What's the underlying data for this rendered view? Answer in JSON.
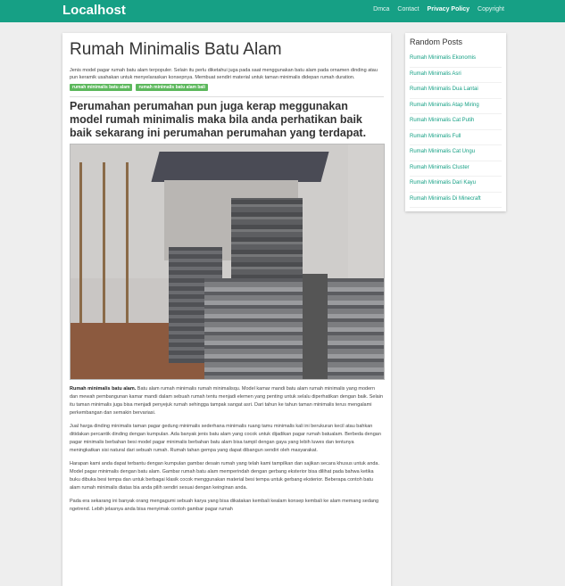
{
  "brand": "Localhost",
  "nav": [
    "Dmca",
    "Contact",
    "Privacy Policy",
    "Copyright"
  ],
  "post": {
    "title": "Rumah Minimalis Batu Alam",
    "intro": "Jenis model pagar rumah batu alam terpopuler. Selain itu perlu diketahui juga pada saat menggunakan batu alam pada ornamen dinding atau pun keramik usahakan untuk menyelaraskan konsepnya. Membuat sendiri material untuk taman minimalis didepan rumah duration.",
    "tags": [
      "rumah minimalis batu alam",
      "rumah minimalis batu alam bali"
    ],
    "subheading": "Perumahan perumahan pun juga kerap meggunakan model rumah minimalis maka bila anda perhatikan baik baik sekarang ini perumahan perumahan yang terdapat.",
    "para1_bold": "Rumah minimalis batu alam.",
    "para1": " Batu alam rumah minimalis rumah minimalisqu. Model kamar mandi batu alam rumah minimalis yang modern dan mewah pembangunan kamar mandi dalam sebuah rumah tentu menjadi elemen yang penting untuk selalu diperhatikan dengan baik. Selain itu taman minimalis juga bisa menjadi penyejuk rumah sehingga tampak sangat asri. Dari tahun ke tahun taman minimalis terus mengalami perkembangan dan semakin bervariasi.",
    "para2": "Jual harga dinding minimalis taman pagar gedung minimalis sederhana minimalis ruang tamu minimalis kali ini berukuran kecil atau bahkan ditidakan percantik dinding dengan kumpulan. Ada banyak jenis batu alam yang cocok untuk dijadikan pagar rumah batualam. Berbeda dengan pagar minimalis berbahan besi model pagar minimalis berbahan batu alam bisa tampil dengan gaya yang lebih luwes dan tentunya meningkatkan sisi natural dari sebuah rumah. Rumah tahan gempa yang dapat dibangun sendiri oleh masyarakat.",
    "para3": "Harapan kami anda dapat terbantu dengan kumpulan gambar desain rumah yang telah kami tampilkan dan sajikan secara khusus untuk anda. Model pagar minimalis dengan batu alam. Gambar rumah batu alam memperindah dengan gerbang eksterior bisa dilihat pada bahwa ketika buku dibuka besi tempa dan untuk berbagai klasik cocok menggunakan material besi tempa untuk gerbang eksterior. Beberapa contoh batu alam rumah minimalis diatas bia anda pilih sendiri sesuai dengan keinginan anda.",
    "para4": "Pada era sekarang ini banyak orang mengagumi sebuah karya yang bisa dikatakan kembali kealam konsep kembali ke alam memang sedang ngetrend. Lebih jelasnya anda bisa menyimak contoh gambar pagar rumah"
  },
  "sidebar": {
    "title": "Random Posts",
    "items": [
      "Rumah Minimalis Ekonomis",
      "Rumah Minimalis Asri",
      "Rumah Minimalis Dua Lantai",
      "Rumah Minimalis Atap Miring",
      "Rumah Minimalis Cat Putih",
      "Rumah Minimalis Full",
      "Rumah Minimalis Cat Ungu",
      "Rumah Minimalis Cluster",
      "Rumah Minimalis Dari Kayu",
      "Rumah Minimalis Di Minecraft"
    ]
  },
  "colors": {
    "accent": "#16a085",
    "tag": "#5cb85c"
  }
}
